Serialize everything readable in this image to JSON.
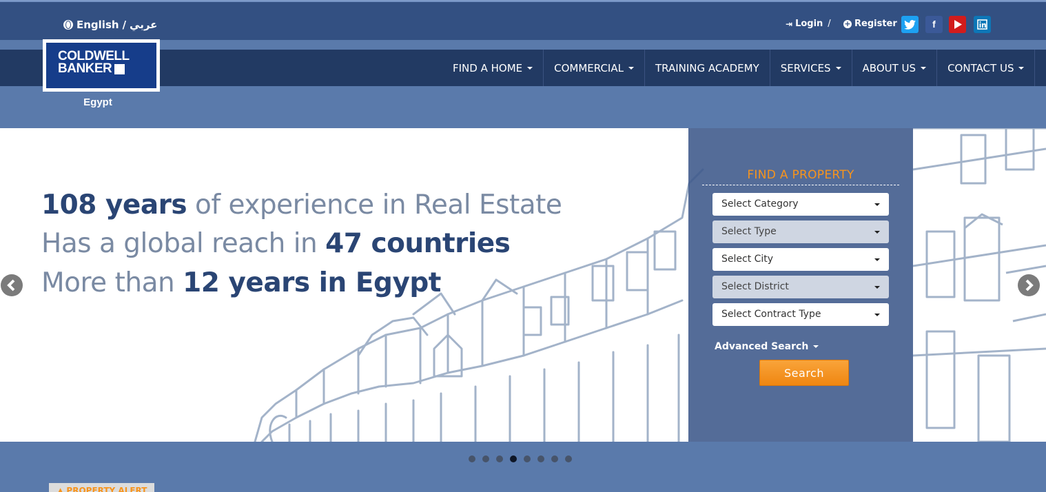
{
  "header": {
    "lang_english": "English",
    "lang_separator": "/",
    "lang_arabic": "عربي",
    "login_label": "Login",
    "auth_separator": "/",
    "register_label": "Register",
    "social_icons": [
      "twitter-icon",
      "facebook-icon",
      "youtube-icon",
      "linkedin-icon"
    ]
  },
  "logo": {
    "line1": "COLDWELL",
    "line2": "BANKER",
    "country": "Egypt"
  },
  "nav": {
    "items": [
      {
        "label": "FIND A HOME",
        "dropdown": true
      },
      {
        "label": "COMMERCIAL",
        "dropdown": true
      },
      {
        "label": "TRAINING ACADEMY",
        "dropdown": false
      },
      {
        "label": "SERVICES",
        "dropdown": true
      },
      {
        "label": "ABOUT US",
        "dropdown": true
      },
      {
        "label": "CONTACT US",
        "dropdown": true
      }
    ]
  },
  "hero": {
    "line1_bold": "108 years",
    "line1_rest": " of experience in Real Estate",
    "line2_start": "Has a global reach in ",
    "line2_bold": "47 countries",
    "line3_start": "More than ",
    "line3_bold": "12 years in Egypt",
    "slide_count": 8,
    "active_slide": 4
  },
  "search": {
    "title": "FIND A PROPERTY",
    "category_placeholder": "Select Category",
    "type_placeholder": "Select Type",
    "city_placeholder": "Select City",
    "district_placeholder": "Select District",
    "contract_placeholder": "Select Contract Type",
    "advanced_label": "Advanced Search",
    "search_button": "Search"
  },
  "footer": {
    "alert_label": "PROPERTY ALERT"
  },
  "colors": {
    "page_bg": "#5a7aab",
    "topbar": "#335082",
    "navbar": "#223a63",
    "accent": "#f7941d"
  }
}
